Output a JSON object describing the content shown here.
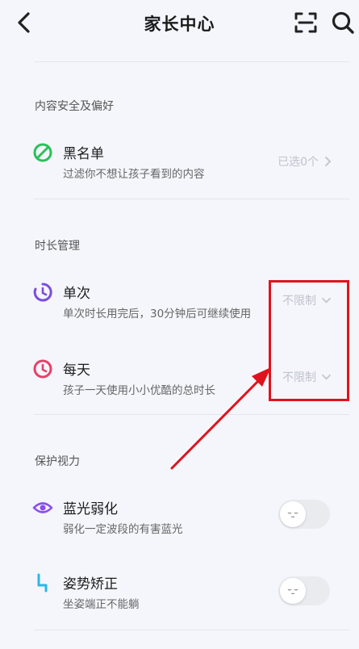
{
  "header": {
    "title": "家长中心"
  },
  "sections": {
    "content": {
      "title": "内容安全及偏好",
      "blacklist": {
        "label": "黑名单",
        "desc": "过滤你不想让孩子看到的内容",
        "value": "已选0个"
      }
    },
    "time": {
      "title": "时长管理",
      "single": {
        "label": "单次",
        "desc": "单次时长用完后，30分钟后可继续使用",
        "value": "不限制"
      },
      "daily": {
        "label": "每天",
        "desc": "孩子一天使用小小优酷的总时长",
        "value": "不限制"
      }
    },
    "vision": {
      "title": "保护视力",
      "bluelight": {
        "label": "蓝光弱化",
        "desc": "弱化一定波段的有害蓝光",
        "enabled": false
      },
      "posture": {
        "label": "姿势矫正",
        "desc": "坐姿端正不能躺",
        "enabled": false
      }
    }
  },
  "colors": {
    "background": "#f4f6fb",
    "blacklist_icon": "#2bbf5a",
    "single_icon": "#7b4de0",
    "daily_icon": "#e84067",
    "bluelight_icon": "#8a4ff0",
    "posture_icon": "#2ab8e6",
    "annotation": "#e0131c"
  },
  "icons": {
    "back": "chevron-left-icon",
    "scan": "scan-icon",
    "search": "search-icon",
    "blacklist": "no-entry-icon",
    "single": "clock-icon",
    "daily": "clock-icon",
    "bluelight": "eye-icon",
    "posture": "posture-icon"
  }
}
